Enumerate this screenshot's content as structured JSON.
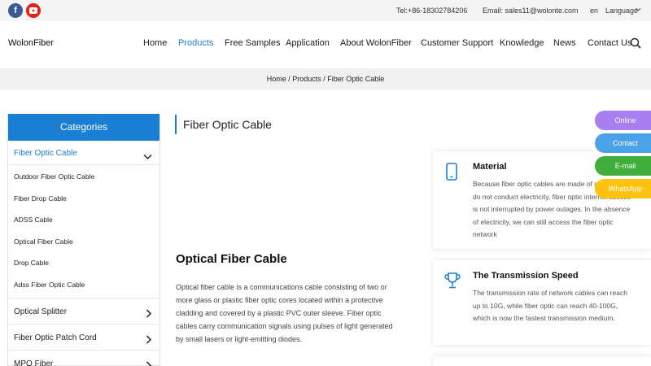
{
  "topbar": {
    "facebook_glyph": "f",
    "tel": "Tel:+86-18302784206",
    "email": "Email: sales11@wolonte.com",
    "lang_code": "en",
    "language_label": "Language"
  },
  "header": {
    "logo": "WolonFiber",
    "nav": [
      {
        "label": "Home"
      },
      {
        "label": "Products",
        "active": true
      },
      {
        "label": "Free Samples"
      },
      {
        "label": "Application"
      },
      {
        "label": "About WolonFiber"
      },
      {
        "label": "Customer Support"
      },
      {
        "label": "Knowledge"
      },
      {
        "label": "News"
      },
      {
        "label": "Contact Us"
      }
    ]
  },
  "breadcrumb": {
    "text": "Home / Products / Fiber Optic Cable"
  },
  "sidebar": {
    "heading": "Categories",
    "active_category": "Fiber Optic Cable",
    "subcategories": [
      "Outdoor Fiber Optic Cable",
      "Fiber Drop Cable",
      "ADSS Cable",
      "Optical Fiber Cable",
      "Drop Cable",
      "Adss Fiber Optic Cable"
    ],
    "categories": [
      "Optical Splitter",
      "Fiber Optic Patch Cord",
      "MPO Fiber"
    ]
  },
  "main": {
    "page_title": "Fiber Optic Cable",
    "heading": "Optical Fiber Cable",
    "paragraph": "Optical fiber cable is a communications cable consisting of two or more glass or plastic fiber optic cores located within a protective cladding and covered by a plastic PVC outer sleeve. Fiber optic cables carry communication signals using pulses of light generated by small lasers or light-emitting diodes."
  },
  "features": [
    {
      "title": "Material",
      "icon": "phone-icon",
      "text": "Because fiber optic cables are made of glass and do not conduct electricity, fiber optic internet access is not interrupted by power outages. In the absence of electricity, we can still access the fiber optic network"
    },
    {
      "title": "The Transmission Speed",
      "icon": "trophy-icon",
      "text": "The transmission rate of network cables can reach up to 10G, while fiber optic can reach 40-100G, which is now the fastest transmission medium."
    }
  ],
  "float_tabs": {
    "online": "Online",
    "contact": "Contact",
    "email": "E-mail",
    "whatsapp": "WhatsApp"
  },
  "colors": {
    "accent": "#1a7fd3",
    "facebook": "#3b5998",
    "youtube": "#e62117",
    "online": "#a77fef",
    "contact": "#4aa3e8",
    "email": "#3fae3c",
    "whatsapp": "#ffc20e"
  }
}
